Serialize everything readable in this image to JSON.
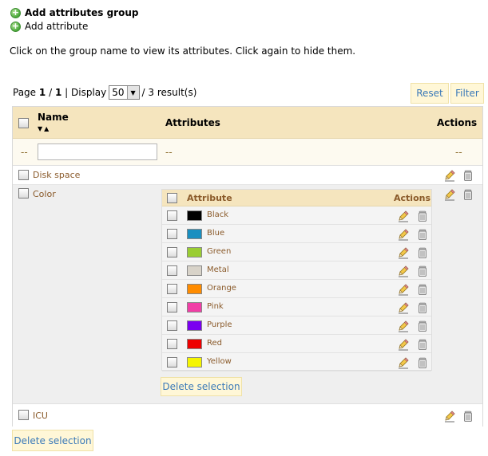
{
  "links": {
    "add_group": "Add attributes group",
    "add_attribute": "Add attribute"
  },
  "instructions": "Click on the group name to view its attributes. Click again to hide them.",
  "pager": {
    "page_label": "Page",
    "page_current": "1",
    "page_sep": "/",
    "page_total": "1",
    "display_label": "| Display",
    "per_page": "50",
    "results": "/ 3 result(s)"
  },
  "buttons": {
    "reset": "Reset",
    "filter": "Filter",
    "delete_selection": "Delete selection"
  },
  "table": {
    "headers": {
      "name": "Name",
      "attributes": "Attributes",
      "actions": "Actions"
    },
    "sort_arrows": "▼▲",
    "filter_placeholder": "--",
    "filter_actions": "--",
    "name_filter_value": "",
    "rows": [
      {
        "name": "Disk space"
      },
      {
        "name": "Color"
      },
      {
        "name": "ICU"
      }
    ]
  },
  "color_attributes": {
    "headers": {
      "attribute": "Attribute",
      "actions": "Actions"
    },
    "items": [
      {
        "label": "Black",
        "color": "#000000"
      },
      {
        "label": "Blue",
        "color": "#1a8fc0"
      },
      {
        "label": "Green",
        "color": "#9acd32"
      },
      {
        "label": "Metal",
        "color": "#d8d3c9"
      },
      {
        "label": "Orange",
        "color": "#ff8c00"
      },
      {
        "label": "Pink",
        "color": "#f13ea6"
      },
      {
        "label": "Purple",
        "color": "#7a00f0"
      },
      {
        "label": "Red",
        "color": "#ee0000"
      },
      {
        "label": "Yellow",
        "color": "#f5f500"
      }
    ]
  },
  "icons": {
    "add": "plus-icon",
    "edit": "pencil-edit-icon",
    "delete": "trash-icon",
    "dropdown": "chevron-down-icon"
  }
}
